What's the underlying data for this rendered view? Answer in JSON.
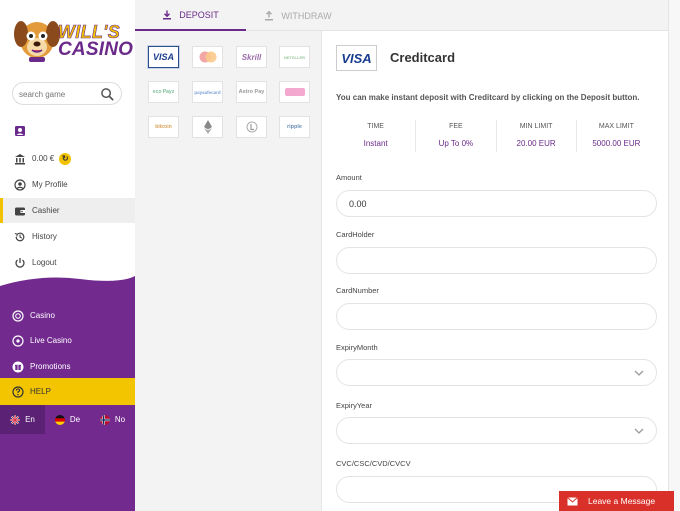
{
  "brand": {
    "line1": "WILL'S",
    "line2": "CASINO"
  },
  "search": {
    "placeholder": "search game"
  },
  "account": {
    "balance": "0.00 €",
    "items": [
      {
        "label": "My Profile",
        "icon": "user-circle-icon"
      },
      {
        "label": "Cashier",
        "icon": "wallet-icon"
      },
      {
        "label": "History",
        "icon": "history-icon"
      },
      {
        "label": "Logout",
        "icon": "power-icon"
      }
    ]
  },
  "nav": {
    "items": [
      {
        "label": "Casino",
        "icon": "casino-chip-icon"
      },
      {
        "label": "Live Casino",
        "icon": "live-casino-icon"
      },
      {
        "label": "Promotions",
        "icon": "gift-icon"
      }
    ],
    "help": "HELP"
  },
  "languages": [
    {
      "code": "En",
      "flag": "uk-flag-icon",
      "selected": true
    },
    {
      "code": "De",
      "flag": "germany-flag-icon",
      "selected": false
    },
    {
      "code": "No",
      "flag": "norway-flag-icon",
      "selected": false
    }
  ],
  "tabs": {
    "deposit": "DEPOSIT",
    "withdraw": "WITHDRAW",
    "active": "deposit"
  },
  "methods": {
    "visa": "VISA",
    "mastercard": "mastercard",
    "skrill": "Skrill",
    "neteller": "NETELLER",
    "ecopayz": "eco Payz",
    "paysafe": "paysafecard",
    "astropay": "Astro Pay",
    "bitcoin": "bitcoin",
    "ripple": "ripple"
  },
  "selected_method": {
    "logo": "VISA",
    "title": "Creditcard",
    "description": "You can make instant deposit with Creditcard by clicking on the Deposit button.",
    "info": [
      {
        "label": "TIME",
        "value": "Instant"
      },
      {
        "label": "FEE",
        "value": "Up To 0%"
      },
      {
        "label": "MIN LIMIT",
        "value": "20.00 EUR"
      },
      {
        "label": "MAX LIMIT",
        "value": "5000.00 EUR"
      }
    ]
  },
  "form": {
    "amount_label": "Amount",
    "amount_value": "0.00",
    "cardholder_label": "CardHolder",
    "cardnumber_label": "CardNumber",
    "expiry_month_label": "ExpiryMonth",
    "expiry_year_label": "ExpiryYear",
    "cvc_label": "CVC/CSC/CVD/CVCV"
  },
  "chat": {
    "label": "Leave a Message"
  },
  "colors": {
    "purple": "#6b2a8a",
    "yellow": "#f2c500",
    "chat_red": "#d9302a"
  }
}
